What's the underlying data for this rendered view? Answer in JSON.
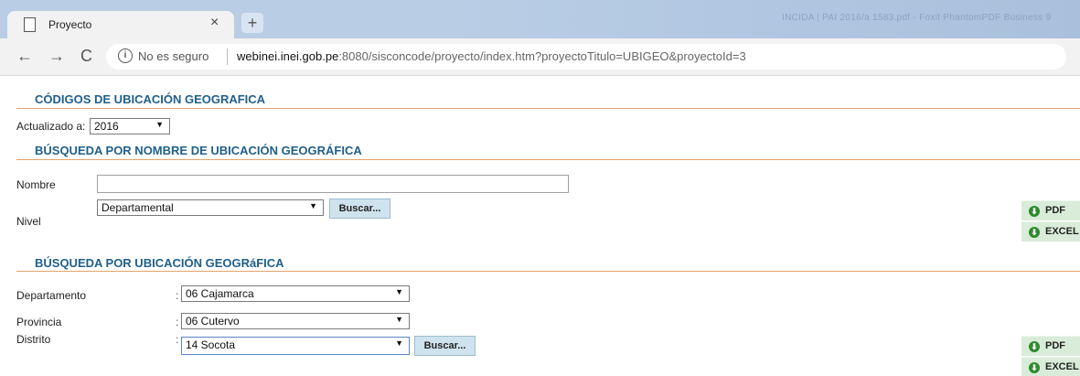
{
  "browser": {
    "tab_title": "Proyecto",
    "tab_close": "×",
    "new_tab": "+",
    "window_title": "INCIDA | PAI 2016/a 1583.pdf - Foxit PhantomPDF Business 9",
    "nav": {
      "back": "←",
      "forward": "→",
      "reload": "C"
    },
    "info_glyph": "i",
    "security": "No es seguro",
    "url_host": "webinei.inei.gob.pe",
    "url_rest": ":8080/sisconcode/proyecto/index.htm?proyectoTitulo=UBIGEO&proyectoId=3"
  },
  "page": {
    "title": "CÓDIGOS DE UBICACIÓN GEOGRAFICA",
    "updated_label": "Actualizado a:",
    "updated_value": "2016",
    "search_name": {
      "title": "BÚSQUEDA POR NOMBRE DE UBICACIÓN GEOGRÁFICA",
      "name_label": "Nombre",
      "name_value": "",
      "level_label": "Nivel",
      "level_value": "Departamental",
      "search_button": "Buscar...",
      "pdf_button": "PDF",
      "excel_button": "EXCEL"
    },
    "search_location": {
      "title": "BÚSQUEDA POR UBICACIÓN GEOGRáFICA",
      "colon": ":",
      "department_label": "Departamento",
      "department_value": "06 Cajamarca",
      "province_label": "Provincia",
      "province_value": "06 Cutervo",
      "district_label": "Distrito",
      "district_value": "14 Socota",
      "search_button": "Buscar...",
      "pdf_button": "PDF",
      "excel_button": "EXCEL"
    }
  },
  "icons": {
    "dropdown": "▼",
    "download": "⬇"
  },
  "colors": {
    "section_title": "#1f5f8b",
    "rule": "#e3a36b",
    "button": "#cfe3ee",
    "export": "#d9ecd9"
  }
}
